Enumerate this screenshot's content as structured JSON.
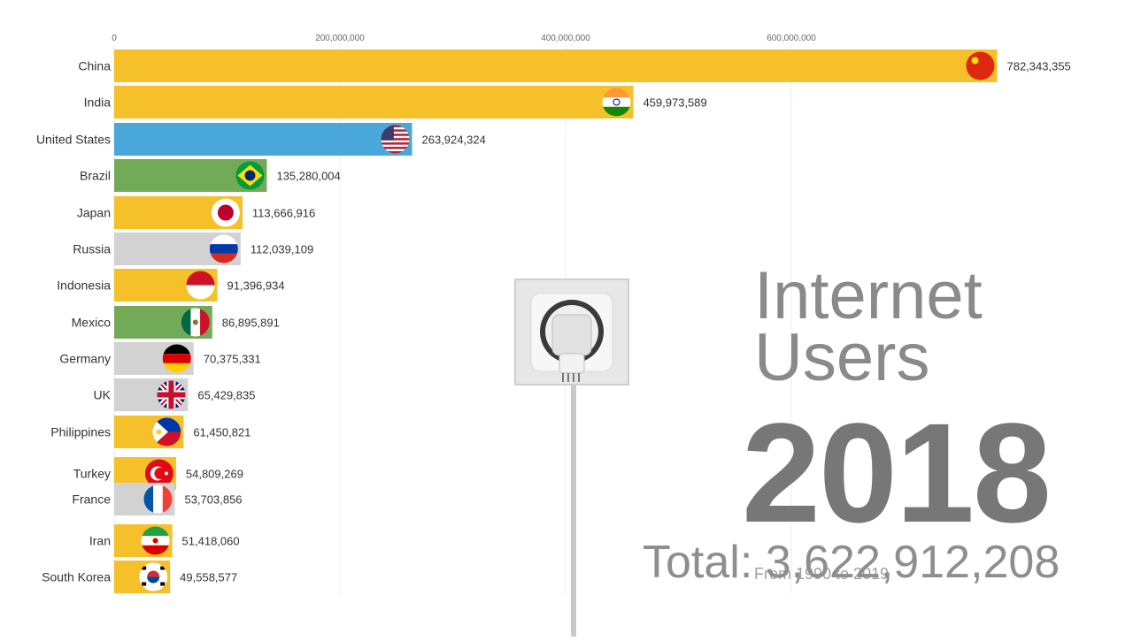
{
  "title": "Internet Users",
  "title_lines": [
    "Internet",
    "Users"
  ],
  "year": "2018",
  "total_text": "Total: 3,622,912,208",
  "subtitle": "From 1990 to 2019",
  "colors": {
    "yellow": "#f6c02b",
    "blue": "#4aa7d9",
    "green": "#73aa58",
    "gray": "#d2d2d2",
    "text": "#333333"
  },
  "chart_data": {
    "type": "bar",
    "orientation": "horizontal",
    "xlim": [
      0,
      800000000
    ],
    "xticks": [
      {
        "value": 0,
        "label": "0"
      },
      {
        "value": 200000000,
        "label": "200,000,000"
      },
      {
        "value": 400000000,
        "label": "400,000,000"
      },
      {
        "value": 600000000,
        "label": "600,000,000"
      }
    ],
    "categories": [
      "China",
      "India",
      "United States",
      "Brazil",
      "Japan",
      "Russia",
      "Indonesia",
      "Mexico",
      "Germany",
      "UK",
      "Philippines",
      "Turkey",
      "France",
      "Iran",
      "South Korea"
    ],
    "values": [
      782343355,
      459973589,
      263924324,
      135280004,
      113666916,
      112039109,
      91396934,
      86895891,
      70375331,
      65429835,
      61450821,
      54809269,
      53703856,
      51418060,
      49558577
    ],
    "value_labels": [
      "782,343,355",
      "459,973,589",
      "263,924,324",
      "135,280,004",
      "113,666,916",
      "112,039,109",
      "91,396,934",
      "86,895,891",
      "70,375,331",
      "65,429,835",
      "61,450,821",
      "54,809,269",
      "53,703,856",
      "51,418,060",
      "49,558,577"
    ],
    "bar_colors": [
      "#f6c02b",
      "#f6c02b",
      "#4aa7d9",
      "#73aa58",
      "#f6c02b",
      "#d2d2d2",
      "#f6c02b",
      "#73aa58",
      "#d2d2d2",
      "#d2d2d2",
      "#f6c02b",
      "#f6c02b",
      "#d2d2d2",
      "#f6c02b",
      "#f6c02b"
    ],
    "flags": [
      "china-flag-icon",
      "india-flag-icon",
      "usa-flag-icon",
      "brazil-flag-icon",
      "japan-flag-icon",
      "russia-flag-icon",
      "indonesia-flag-icon",
      "mexico-flag-icon",
      "germany-flag-icon",
      "uk-flag-icon",
      "philippines-flag-icon",
      "turkey-flag-icon",
      "france-flag-icon",
      "iran-flag-icon",
      "south-korea-flag-icon"
    ]
  },
  "decoration": {
    "icon": "power-plug-socket-icon"
  }
}
